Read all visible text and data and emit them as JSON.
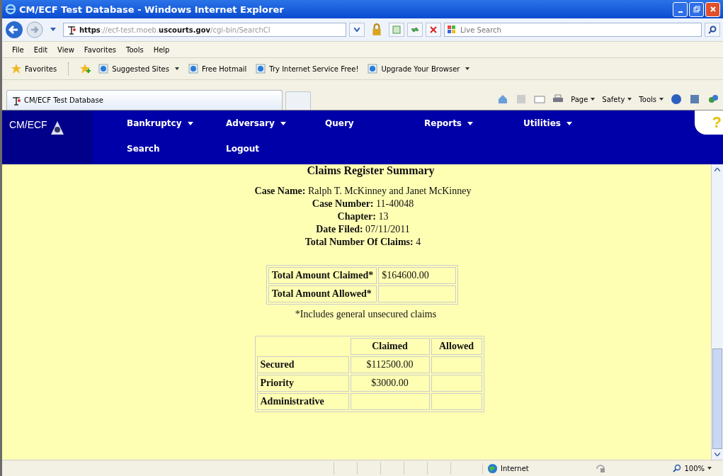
{
  "window": {
    "title": "CM/ECF Test Database - Windows Internet Explorer"
  },
  "address_bar": {
    "url": "**https**://ecf-test.moeb.**uscourts.gov**/cgi-bin/SearchCl",
    "search_placeholder": "Live Search"
  },
  "menu_bar": [
    "File",
    "Edit",
    "View",
    "Favorites",
    "Tools",
    "Help"
  ],
  "favorites_bar": {
    "favorites": "Favorites",
    "links": [
      {
        "label": "Suggested Sites",
        "dropdown": true
      },
      {
        "label": "Free Hotmail",
        "dropdown": false
      },
      {
        "label": "Try Internet Service Free!",
        "dropdown": false
      },
      {
        "label": "Upgrade Your Browser",
        "dropdown": true
      }
    ]
  },
  "tab": {
    "title": "CM/ECF Test Database"
  },
  "command_bar": [
    "Page",
    "Safety",
    "Tools"
  ],
  "site_nav": {
    "logo": "CM/ECF",
    "items": [
      {
        "label": "Bankruptcy",
        "dropdown": true
      },
      {
        "label": "Adversary",
        "dropdown": true
      },
      {
        "label": "Query",
        "dropdown": false
      },
      {
        "label": "Reports",
        "dropdown": true
      },
      {
        "label": "Utilities",
        "dropdown": true
      },
      {
        "label": "Search",
        "dropdown": false
      },
      {
        "label": "Logout",
        "dropdown": false
      }
    ],
    "help": "?"
  },
  "page": {
    "heading": "Claims Register Summary",
    "case_info": [
      {
        "label": "Case Name:",
        "value": "Ralph T. McKinney and Janet McKinney"
      },
      {
        "label": "Case Number:",
        "value": "11-40048"
      },
      {
        "label": "Chapter:",
        "value": "13"
      },
      {
        "label": "Date Filed:",
        "value": "07/11/2011"
      },
      {
        "label": "Total Number Of Claims:",
        "value": "4"
      }
    ],
    "totals": [
      {
        "label": "Total Amount Claimed*",
        "value": "$164600.00"
      },
      {
        "label": "Total Amount Allowed*"
      }
    ],
    "footnote": "*Includes general unsecured claims",
    "breakdown": {
      "columns": [
        "Claimed",
        "Allowed"
      ],
      "rows": [
        {
          "label": "Secured",
          "claimed": "$112500.00"
        },
        {
          "label": "Priority",
          "claimed": "$3000.00"
        },
        {
          "label": "Administrative"
        }
      ]
    }
  },
  "status_bar": {
    "zone": "Internet",
    "zoom": "100%"
  }
}
